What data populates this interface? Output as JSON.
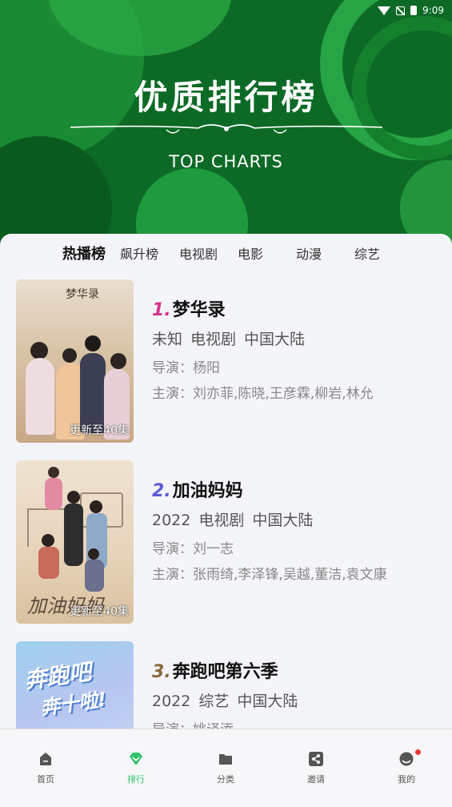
{
  "statusbar": {
    "time": "9:09"
  },
  "banner": {
    "title": "优质排行榜",
    "subtitle": "TOP CHARTS"
  },
  "tabs": [
    {
      "label": "热播榜",
      "active": true
    },
    {
      "label": "飙升榜"
    },
    {
      "label": "电视剧"
    },
    {
      "label": "电影"
    },
    {
      "label": "动漫"
    },
    {
      "label": "综艺"
    }
  ],
  "items": [
    {
      "rank": "1.",
      "rank_color": "#d8318c",
      "title": "梦华录",
      "year": "未知",
      "type": "电视剧",
      "region": "中国大陆",
      "director": "导演：杨阳",
      "cast": "主演：刘亦菲,陈晓,王彦霖,柳岩,林允",
      "badge": "更新至40集"
    },
    {
      "rank": "2.",
      "rank_color": "#5b5bd6",
      "title": "加油妈妈",
      "year": "2022",
      "type": "电视剧",
      "region": "中国大陆",
      "director": "导演：刘一志",
      "cast": "主演：张雨绮,李泽锋,吴越,董洁,袁文康",
      "badge": "更新至40集"
    },
    {
      "rank": "3.",
      "rank_color": "#8a6a3d",
      "title": "奔跑吧第六季",
      "year": "2022",
      "type": "综艺",
      "region": "中国大陆",
      "director": "导演：姚译添",
      "cast": "",
      "badge": ""
    }
  ],
  "nav": [
    {
      "label": "首页",
      "icon": "home-icon"
    },
    {
      "label": "排行",
      "icon": "rank-diamond-icon",
      "active": true
    },
    {
      "label": "分类",
      "icon": "folder-icon"
    },
    {
      "label": "邀请",
      "icon": "share-icon"
    },
    {
      "label": "我的",
      "icon": "profile-icon",
      "notification": true
    }
  ],
  "colors": {
    "accent": "#2fc36b",
    "banner": "#0d6a26"
  }
}
